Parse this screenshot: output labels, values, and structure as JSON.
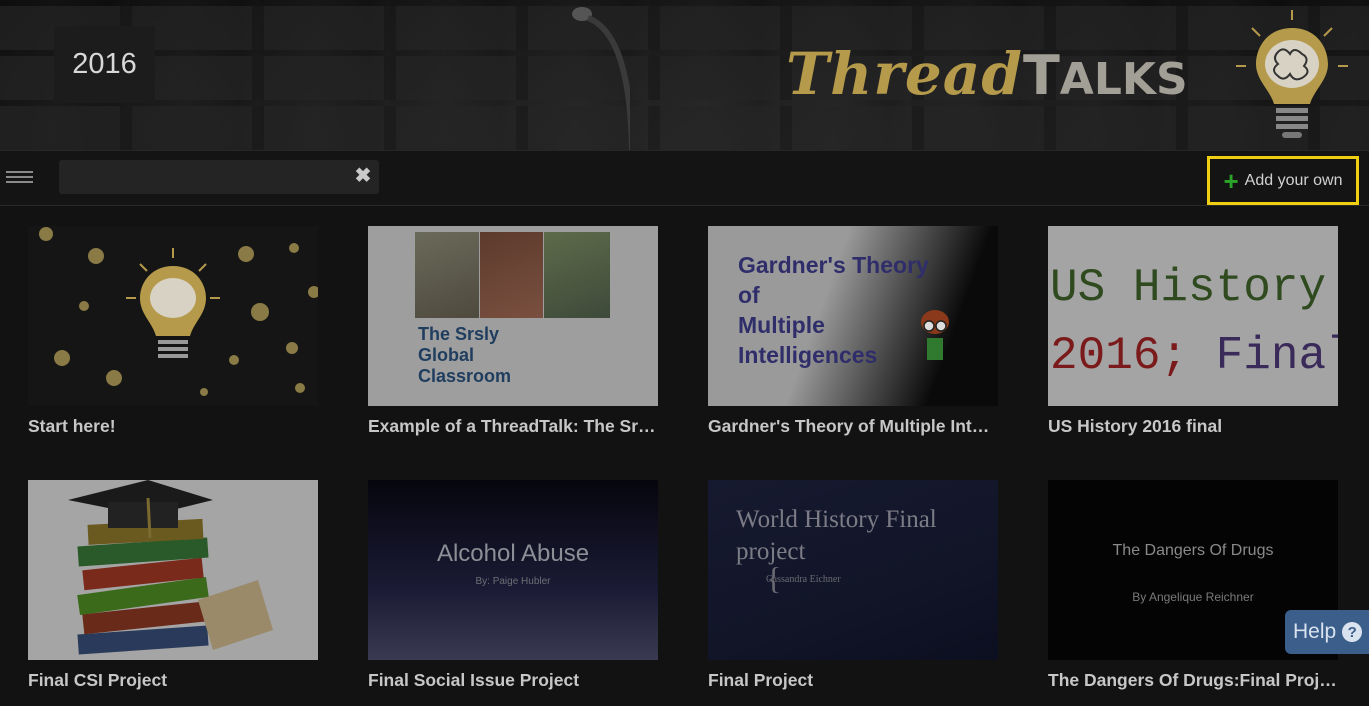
{
  "header": {
    "year": "2016",
    "brand_thread": "Thread",
    "brand_talks_first": "T",
    "brand_talks_rest": "ALKS"
  },
  "toolbar": {
    "search_value": "",
    "search_placeholder": "",
    "clear_icon": "close-icon",
    "add_label": "Add your own",
    "add_icon": "plus-icon",
    "highlight_color": "#f0cf12"
  },
  "cards": [
    {
      "title": "Start here!"
    },
    {
      "title": "Example of a ThreadTalk: The Srsly Global Classroom",
      "thumb_text": [
        "The Srsly",
        "Global",
        "Classroom"
      ]
    },
    {
      "title": "Gardner's Theory of Multiple Intelligences",
      "thumb_text": [
        "Gardner's Theory",
        "of",
        "Multiple",
        "Intelligences"
      ]
    },
    {
      "title": "US History 2016 final",
      "thumb_line1": "US History",
      "thumb_line2a": "2016;",
      "thumb_line2b": "Final"
    },
    {
      "title": "Final CSI Project"
    },
    {
      "title": "Final Social Issue Project",
      "thumb_title": "Alcohol Abuse",
      "thumb_sub": "By: Paige Hubler"
    },
    {
      "title": "Final Project",
      "thumb_title": "World History Final project",
      "thumb_sub": "Cassandra Eichner"
    },
    {
      "title": "The Dangers Of Drugs:Final Project",
      "thumb_title": "The Dangers Of Drugs",
      "thumb_sub": "By Angelique Reichner"
    }
  ],
  "help": {
    "label": "Help",
    "icon": "question-icon"
  }
}
